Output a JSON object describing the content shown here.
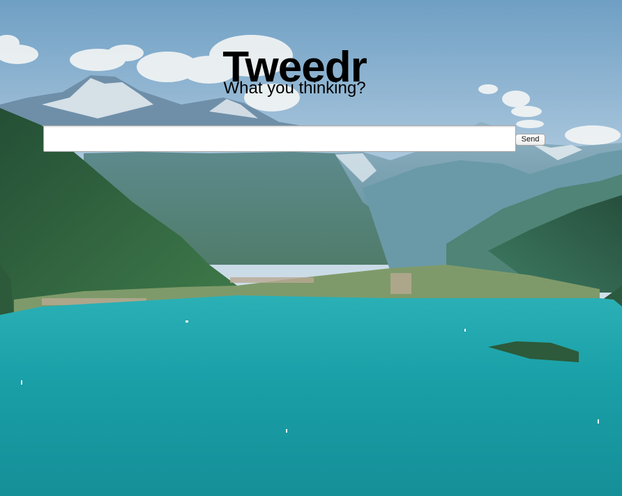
{
  "header": {
    "title": "Tweedr",
    "subtitle": "What you thinking?"
  },
  "compose": {
    "input_value": "",
    "input_placeholder": "",
    "send_label": "Send"
  },
  "background": {
    "scene": "mountain-lake-landscape",
    "sky_color": "#7ea9c9",
    "lake_color": "#1fa2a7",
    "mountain_color": "#2f6a45"
  }
}
